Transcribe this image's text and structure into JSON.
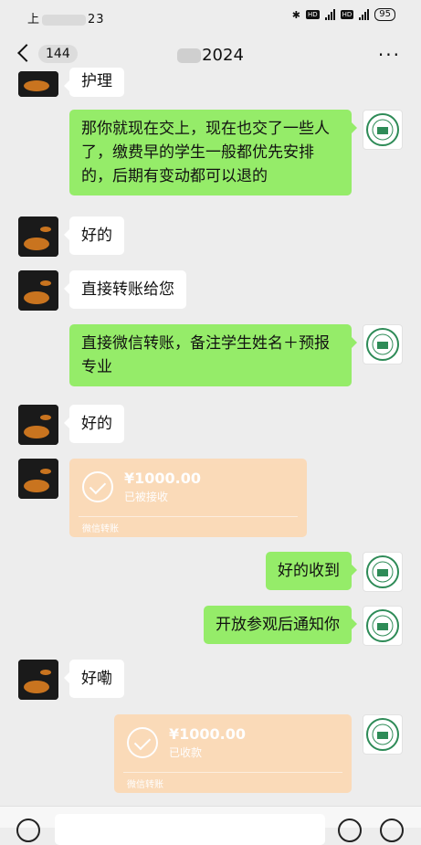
{
  "status_bar": {
    "time_prefix": "上",
    "time_suffix": "23",
    "battery": "95"
  },
  "nav": {
    "unread_count": "144",
    "title": "2024",
    "more": "···"
  },
  "messages": {
    "m1": "护理",
    "m2": "那你就现在交上，现在也交了一些人了，缴费早的学生一般都优先安排的，后期有变动都可以退的",
    "m3": "好的",
    "m4": "直接转账给您",
    "m5": "直接微信转账，备注学生姓名＋预报专业",
    "m6": "好的",
    "m8": "好的收到",
    "m9": "开放参观后通知你",
    "m10": "好嘞"
  },
  "transfers": {
    "t1": {
      "amount": "¥1000.00",
      "status": "已被接收",
      "footer": "微信转账"
    },
    "t2": {
      "amount": "¥1000.00",
      "status": "已收款",
      "footer": "微信转账"
    }
  },
  "colors": {
    "sent_bubble": "#95ec69",
    "received_bubble": "#ffffff",
    "transfer_card": "#fbd9b6",
    "background": "#ededed"
  }
}
